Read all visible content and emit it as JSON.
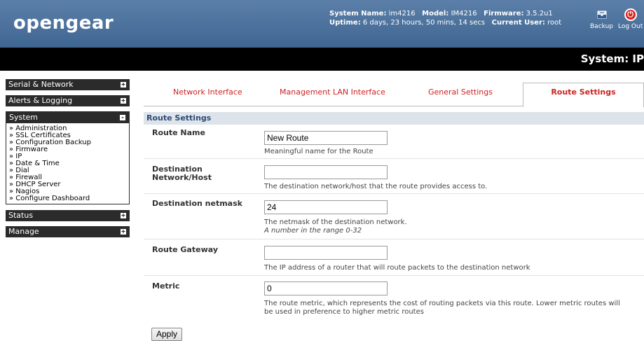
{
  "header": {
    "logo": "opengear",
    "system_name_label": "System Name:",
    "system_name": "im4216",
    "model_label": "Model:",
    "model": "IM4216",
    "firmware_label": "Firmware:",
    "firmware": "3.5.2u1",
    "uptime_label": "Uptime:",
    "uptime": "6 days, 23 hours, 50 mins, 14 secs",
    "user_label": "Current User:",
    "user": "root",
    "backup_label": "Backup",
    "logout_label": "Log Out",
    "backup_icon": "backup-icon",
    "logout_icon": "power-icon",
    "logout_glyph": "⏻"
  },
  "titlebar": {
    "title": "System: IP"
  },
  "sidebar": {
    "serial_network": "Serial & Network",
    "alerts_logging": "Alerts & Logging",
    "system": "System",
    "system_items": [
      "» Administration",
      "» SSL Certificates",
      "» Configuration Backup",
      "» Firmware",
      "» IP",
      "» Date & Time",
      "» Dial",
      "» Firewall",
      "» DHCP Server",
      "» Nagios",
      "» Configure Dashboard"
    ],
    "status": "Status",
    "manage": "Manage",
    "expand_glyph": "+",
    "collapse_glyph": "-"
  },
  "tabs": {
    "network_interface": "Network Interface",
    "management_lan": "Management LAN Interface",
    "general_settings": "General Settings",
    "route_settings": "Route Settings"
  },
  "form": {
    "section_title": "Route Settings",
    "route_name": {
      "label": "Route Name",
      "value": "New Route",
      "desc": "Meaningful name for the Route"
    },
    "destination": {
      "label_line1": "Destination",
      "label_line2": "Network/Host",
      "value": "",
      "desc": "The destination network/host that the route provides access to."
    },
    "netmask": {
      "label": "Destination netmask",
      "value": "24",
      "desc": "The netmask of the destination network.",
      "hint": "A number in the range 0-32"
    },
    "gateway": {
      "label": "Route Gateway",
      "value": "",
      "desc": "The IP address of a router that will route packets to the destination network"
    },
    "metric": {
      "label": "Metric",
      "value": "0",
      "desc_line1": "The route metric, which represents the cost of routing packets via this route. Lower metric routes will",
      "desc_line2": "be used in preference to higher metric routes"
    },
    "apply_label": "Apply"
  },
  "colors": {
    "header": "#4a72a0",
    "tab_text": "#cc2222",
    "section_bg": "#dde3ea",
    "section_text": "#2b4a75"
  }
}
